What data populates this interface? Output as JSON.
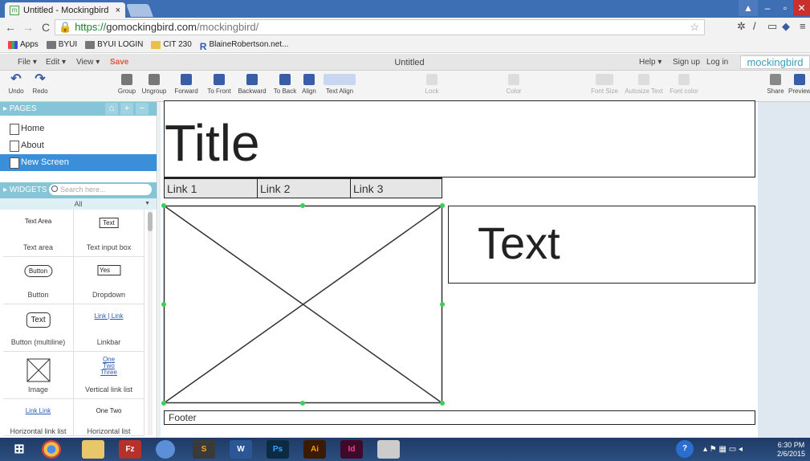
{
  "browser": {
    "tab_title": "Untitled - Mockingbird",
    "tab_close": "×",
    "favicon": "m",
    "url_prefix": "https://",
    "url_host": "gomockingbird.com",
    "url_path": "/mockingbird/",
    "bookmarks": [
      {
        "label": "Apps",
        "icon": "apps-icon"
      },
      {
        "label": "BYUI",
        "icon": "byui-icon"
      },
      {
        "label": "BYUI LOGIN",
        "icon": "byui-icon"
      },
      {
        "label": "CIT 230",
        "icon": "folder-icon"
      },
      {
        "label": "BlaineRobertson.net...",
        "icon": "r-icon",
        "glyph": "R"
      }
    ]
  },
  "menubar": {
    "file": "File ▾",
    "edit": "Edit ▾",
    "view": "View ▾",
    "save": "Save",
    "doc_title": "Untitled",
    "help": "Help ▾",
    "signup": "Sign up",
    "login": "Log in",
    "brand": "mockingbird"
  },
  "toolbar": {
    "undo": "Undo",
    "redo": "Redo",
    "group": "Group",
    "ungroup": "Ungroup",
    "forward": "Forward",
    "to_front": "To Front",
    "backward": "Backward",
    "to_back": "To Back",
    "align": "Align",
    "text_align": "Text Align",
    "lock": "Lock",
    "color": "Color",
    "font_size": "Font Size",
    "autosize": "Autosize Text",
    "font_color": "Font color",
    "share": "Share",
    "preview": "Preview"
  },
  "sidebar": {
    "pages_header": "▸ PAGES",
    "pages": [
      "Home",
      "About",
      "New Screen"
    ],
    "selected_page": "New Screen",
    "widgets_header": "▸ WIDGETS",
    "search_placeholder": "Search here...",
    "filter": "All",
    "widgets": [
      {
        "label": "Text area",
        "preview": "Text Area"
      },
      {
        "label": "Text input box",
        "preview": "Text"
      },
      {
        "label": "Button",
        "preview": "Button"
      },
      {
        "label": "Dropdown",
        "preview": "Yes"
      },
      {
        "label": "Button (multiline)",
        "preview": "Text"
      },
      {
        "label": "Linkbar",
        "preview": "Link | Link"
      },
      {
        "label": "Image",
        "preview": ""
      },
      {
        "label": "Vertical link list",
        "preview": "One Two Three"
      },
      {
        "label": "Horizontal link list",
        "preview": "Link Link"
      },
      {
        "label": "Horizontal list",
        "preview": "One Two"
      }
    ]
  },
  "mockup": {
    "title": "Title",
    "links": [
      "Link 1",
      "Link 2",
      "Link 3"
    ],
    "text": "Text",
    "footer": "Footer"
  },
  "taskbar": {
    "time": "6:30 PM",
    "date": "2/6/2015",
    "apps": [
      "Chrome",
      "Explorer",
      "FileZilla",
      "VirtualBox",
      "Sublime",
      "Word",
      "Photoshop",
      "Illustrator",
      "InDesign",
      "Calculator"
    ]
  }
}
